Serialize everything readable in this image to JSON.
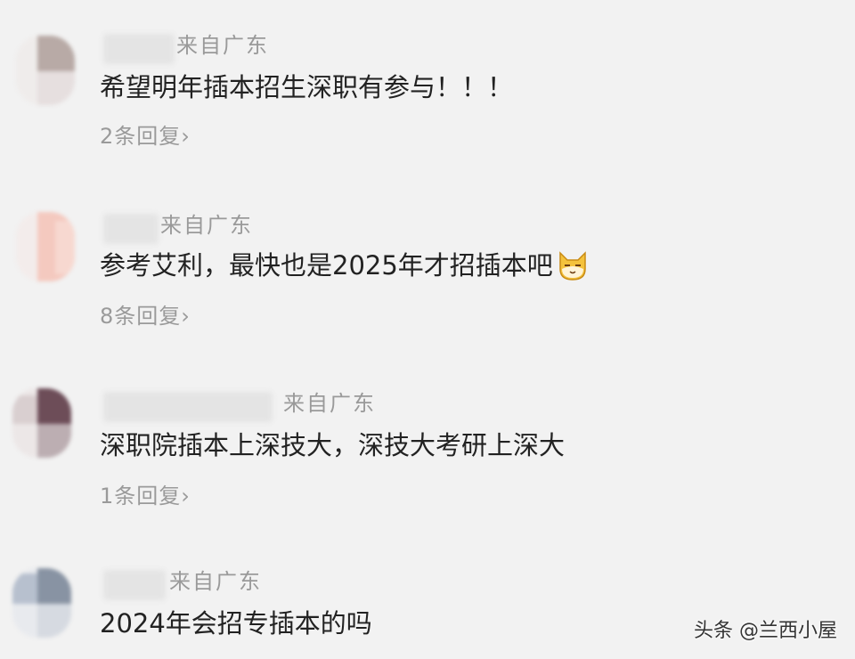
{
  "comments": [
    {
      "location": "来自广东",
      "content": "希望明年插本招生深职有参与！！！",
      "replies": "2条回复›"
    },
    {
      "location": "来自广东",
      "content": "参考艾利，最快也是2025年才招插本吧",
      "emoji": "cat-face-icon",
      "replies": "8条回复›"
    },
    {
      "location": "来自广东",
      "content": "深职院插本上深技大，深技大考研上深大",
      "replies": "1条回复›"
    },
    {
      "location": "来自广东",
      "content": "2024年会招专插本的吗"
    }
  ],
  "watermark": "头条 @兰西小屋"
}
